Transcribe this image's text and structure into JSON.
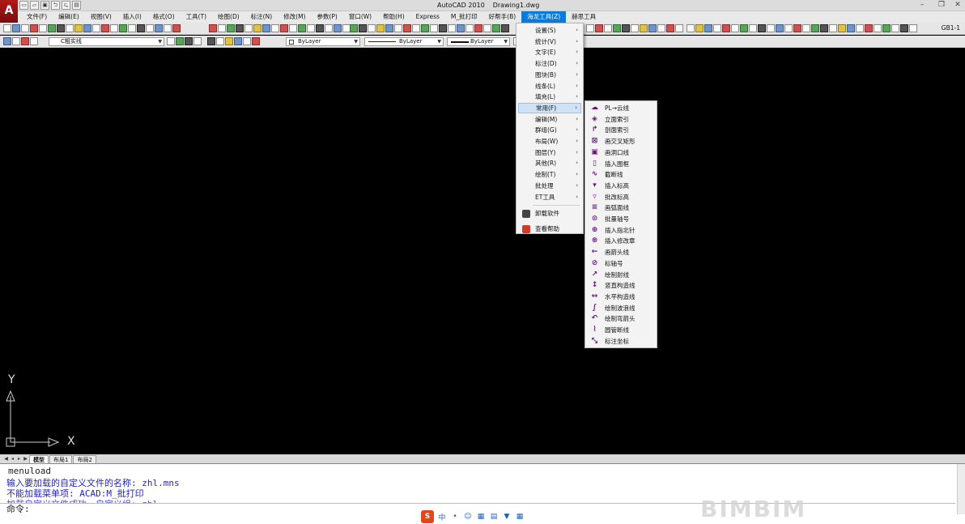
{
  "window": {
    "app_title": "AutoCAD 2010",
    "doc_title": "Drawing1.dwg",
    "minimize": "–",
    "restore": "❐",
    "close": "✕"
  },
  "quick_access": [
    "▭",
    "▱",
    "▣",
    "⮌",
    "⮎",
    "▤"
  ],
  "menubar": [
    "文件(F)",
    "编辑(E)",
    "视图(V)",
    "插入(I)",
    "格式(O)",
    "工具(T)",
    "绘图(D)",
    "标注(N)",
    "修改(M)",
    "参数(P)",
    "窗口(W)",
    "帮助(H)",
    "Express",
    "M_批打印",
    "好帮手(B)",
    "海龙工具(Z)",
    "赫思工具"
  ],
  "menubar_active_index": 15,
  "toolbar": {
    "style_label": "GB1-1"
  },
  "props": {
    "layer_value": "C粗实线",
    "color_value": "ByLayer",
    "linetype_value": "ByLayer",
    "lineweight_value": "ByLayer"
  },
  "ucs": {
    "x_label": "X",
    "y_label": "Y"
  },
  "layout_tabs": [
    "模型",
    "布局1",
    "布局2"
  ],
  "layout_nav": [
    "◀",
    "◂",
    "▸",
    "▶"
  ],
  "command": {
    "history": [
      "menuload",
      "输入要加载的自定义文件的名称: zhl.mns",
      "不能加载菜单项: ACAD:M_批打印",
      "加载自定义文件成功。自定义组: zhl"
    ],
    "prompt": "命令:"
  },
  "ime": [
    "S",
    "中",
    "•",
    "☺",
    "▦",
    "▤",
    "▼",
    "▦"
  ],
  "watermark": "BIMBIM",
  "main_menu": {
    "items": [
      {
        "label": "设置(S)",
        "submenu": true
      },
      {
        "label": "统计(V)",
        "submenu": true
      },
      {
        "label": "文字(E)",
        "submenu": true
      },
      {
        "label": "标注(D)",
        "submenu": true
      },
      {
        "label": "图块(B)",
        "submenu": true
      },
      {
        "label": "线条(L)",
        "submenu": true
      },
      {
        "label": "填充(L)",
        "submenu": true
      },
      {
        "label": "常用(F)",
        "submenu": true,
        "highlighted": true
      },
      {
        "label": "编辑(M)",
        "submenu": true
      },
      {
        "label": "群组(G)",
        "submenu": true
      },
      {
        "label": "布局(W)",
        "submenu": true
      },
      {
        "label": "图层(Y)",
        "submenu": true
      },
      {
        "label": "其他(R)",
        "submenu": true
      },
      {
        "label": "绘制(T)",
        "submenu": true
      },
      {
        "label": "批处理",
        "submenu": true
      },
      {
        "label": "ET工具",
        "submenu": true
      }
    ],
    "extra": [
      {
        "label": "卸载软件",
        "icon": "uninstall-icon",
        "color": "#444444"
      },
      {
        "label": "查看帮助",
        "icon": "help-icon",
        "color": "#d23b2a"
      }
    ],
    "chevron": "›"
  },
  "sub_menu": {
    "items": [
      {
        "label": "PL→云线",
        "icon": "cloud-line-icon",
        "glyph": "☁"
      },
      {
        "label": "立面索引",
        "icon": "elevation-index-icon",
        "glyph": "◈"
      },
      {
        "label": "剖面索引",
        "icon": "section-index-icon",
        "glyph": "↱"
      },
      {
        "label": "画交叉矩形",
        "icon": "cross-rect-icon",
        "glyph": "⊠"
      },
      {
        "label": "画洞口线",
        "icon": "opening-line-icon",
        "glyph": "▣"
      },
      {
        "label": "插入图框",
        "icon": "frame-icon",
        "glyph": "▯"
      },
      {
        "label": "截断线",
        "icon": "break-line-icon",
        "glyph": "∿"
      },
      {
        "label": "插入标高",
        "icon": "elevation-mark-icon",
        "glyph": "▾"
      },
      {
        "label": "批改标高",
        "icon": "batch-elevation-icon",
        "glyph": "▿"
      },
      {
        "label": "画弧面线",
        "icon": "arc-surface-icon",
        "glyph": "≡"
      },
      {
        "label": "批量轴号",
        "icon": "axis-batch-icon",
        "glyph": "⊙"
      },
      {
        "label": "插入指北针",
        "icon": "north-arrow-icon",
        "glyph": "⊕"
      },
      {
        "label": "插入修改章",
        "icon": "revision-stamp-icon",
        "glyph": "⊛"
      },
      {
        "label": "画箭头线",
        "icon": "arrow-line-icon",
        "glyph": "←"
      },
      {
        "label": "标轴号",
        "icon": "axis-tag-icon",
        "glyph": "⊘"
      },
      {
        "label": "绘制射线",
        "icon": "ray-icon",
        "glyph": "↗"
      },
      {
        "label": "竖直构造线",
        "icon": "vertical-xline-icon",
        "glyph": "↕"
      },
      {
        "label": "水平构造线",
        "icon": "horizontal-xline-icon",
        "glyph": "↔"
      },
      {
        "label": "绘制波浪线",
        "icon": "wave-line-icon",
        "glyph": "∫"
      },
      {
        "label": "绘制弯箭头",
        "icon": "bent-arrow-icon",
        "glyph": "↶"
      },
      {
        "label": "圆管断线",
        "icon": "pipe-break-icon",
        "glyph": "⌇"
      },
      {
        "label": "标注坐标",
        "icon": "coord-icon",
        "glyph": "⤡"
      }
    ]
  }
}
